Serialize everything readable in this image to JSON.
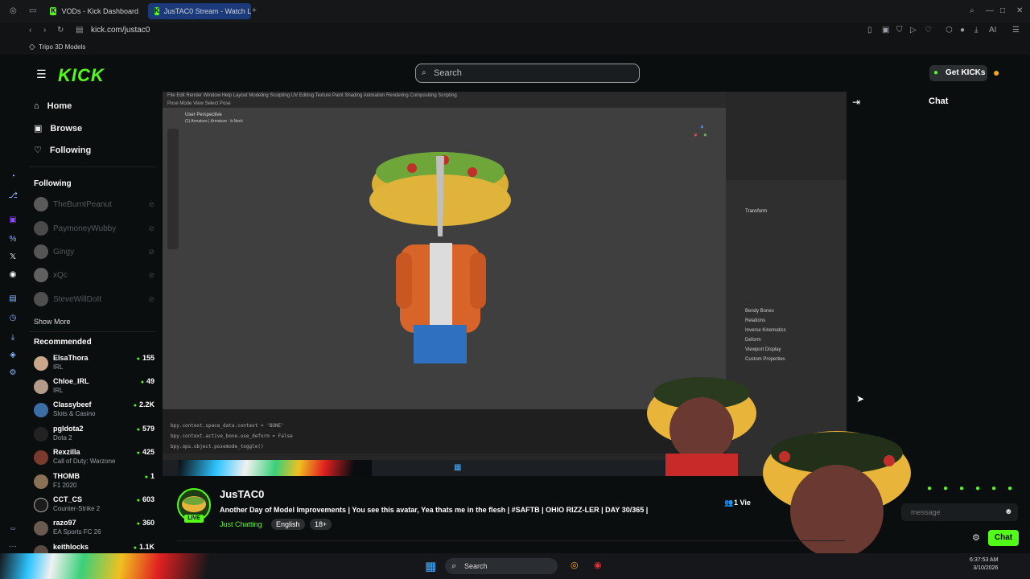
{
  "browser": {
    "tabs": [
      {
        "label": "VODs - Kick Dashboard"
      },
      {
        "label": "JusTAC0 Stream - Watch L"
      }
    ],
    "url": "kick.com/justac0",
    "bookmark": "Tripo 3D Models"
  },
  "kick": {
    "logo": "KICK",
    "search_placeholder": "Search",
    "get_kicks": "Get KICKs",
    "nav": {
      "home": "Home",
      "browse": "Browse",
      "following": "Following"
    },
    "following_title": "Following",
    "following": [
      {
        "name": "TheBurntPeanut"
      },
      {
        "name": "PaymoneyWubby"
      },
      {
        "name": "Gingy"
      },
      {
        "name": "xQc"
      },
      {
        "name": "SteveWillDoIt"
      }
    ],
    "show_more": "Show More",
    "recommended_title": "Recommended",
    "recommended": [
      {
        "name": "ElsaThora",
        "category": "IRL",
        "viewers": "155"
      },
      {
        "name": "Chloe_IRL",
        "category": "IRL",
        "viewers": "49"
      },
      {
        "name": "Classybeef",
        "category": "Slots & Casino",
        "viewers": "2.2K"
      },
      {
        "name": "pgldota2",
        "category": "Dota 2",
        "viewers": "579"
      },
      {
        "name": "Rexzilla",
        "category": "Call of Duty: Warzone",
        "viewers": "425"
      },
      {
        "name": "THOMB",
        "category": "F1 2020",
        "viewers": "1"
      },
      {
        "name": "CCT_CS",
        "category": "Counter-Strike 2",
        "viewers": "603"
      },
      {
        "name": "razo97",
        "category": "EA Sports FC 26",
        "viewers": "360"
      },
      {
        "name": "keithlocks",
        "category": "",
        "viewers": "1.1K"
      }
    ],
    "chat": {
      "title": "Chat",
      "input_placeholder": "message",
      "send_label": "Chat"
    },
    "viewers_label": "1 Vie"
  },
  "stream": {
    "streamer": "JusTAC0",
    "live_label": "LIVE",
    "title": "Another Day of Model Improvements | You see this avatar, Yea thats me in the flesh | #SAFTB | OHIO RIZZ-LER | DAY 30/365 |",
    "category": "Just Chatting",
    "tags": [
      "English",
      "18+"
    ]
  },
  "blender": {
    "viewport_label": "User Perspective",
    "viewport_sub": "(1) Armature | Armature : b.Neck",
    "console_lines": [
      "bpy.context.space_data.context = 'BONE'",
      "bpy.context.active_bone.use_deform = False",
      "bpy.ops.object.posemode_toggle()"
    ],
    "panels": [
      "Transform",
      "Bendy Bones",
      "Relations",
      "Inverse Kinematics",
      "Deform",
      "Viewport Display",
      "Custom Properties"
    ]
  },
  "taskbar": {
    "search": "Search",
    "time": "6:37:53 AM",
    "date": "3/10/2026"
  },
  "colors": {
    "accent": "#53fc18",
    "bg": "#0b0e0f"
  }
}
